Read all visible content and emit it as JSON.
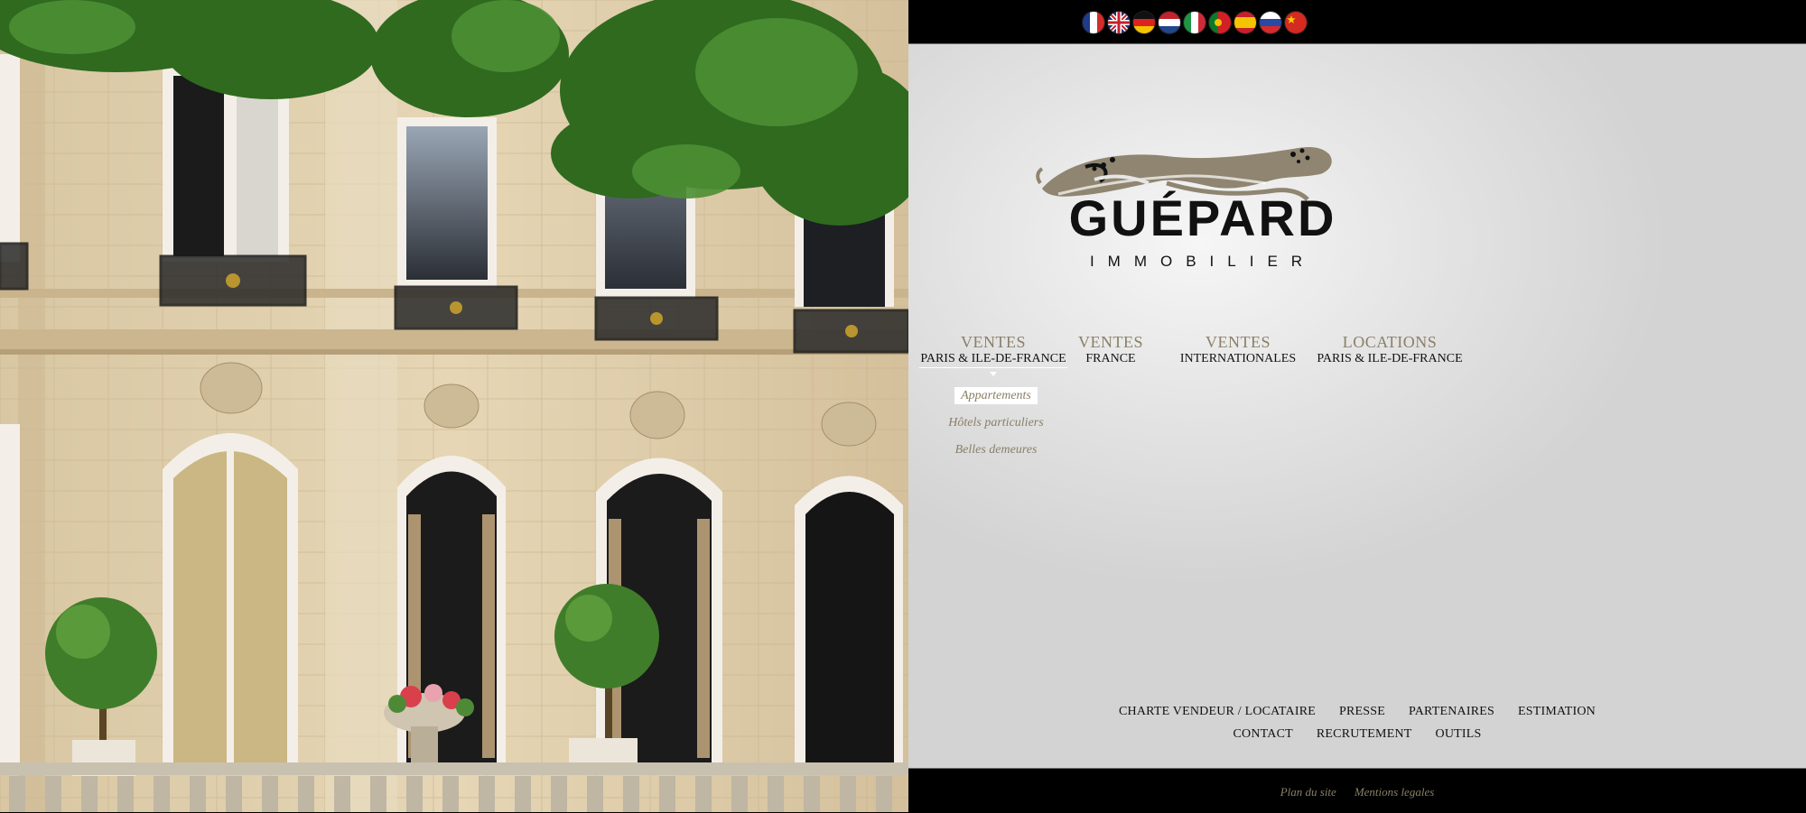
{
  "languages": [
    {
      "code": "fr",
      "icon": "flag-france-icon"
    },
    {
      "code": "en",
      "icon": "flag-uk-icon"
    },
    {
      "code": "de",
      "icon": "flag-germany-icon"
    },
    {
      "code": "nl",
      "icon": "flag-netherlands-icon"
    },
    {
      "code": "it",
      "icon": "flag-italy-icon"
    },
    {
      "code": "pt",
      "icon": "flag-portugal-icon"
    },
    {
      "code": "es",
      "icon": "flag-spain-icon"
    },
    {
      "code": "ru",
      "icon": "flag-russia-icon"
    },
    {
      "code": "cn",
      "icon": "flag-china-icon"
    }
  ],
  "logo": {
    "name": "GUÉPARD",
    "tagline": "IMMOBILIER",
    "icon": "cheetah-logo-icon"
  },
  "nav": [
    {
      "top": "VENTES",
      "sub": "PARIS & ILE-DE-FRANCE",
      "active": true
    },
    {
      "top": "VENTES",
      "sub": "FRANCE"
    },
    {
      "top": "VENTES",
      "sub": "INTERNATIONALES"
    },
    {
      "top": "LOCATIONS",
      "sub": "PARIS & ILE-DE-FRANCE"
    }
  ],
  "submenu": [
    {
      "label": "Appartements",
      "selected": true
    },
    {
      "label": "Hôtels particuliers"
    },
    {
      "label": "Belles demeures"
    }
  ],
  "links_row1": [
    "CHARTE VENDEUR / LOCATAIRE",
    "PRESSE",
    "PARTENAIRES",
    "ESTIMATION"
  ],
  "links_row2": [
    "CONTACT",
    "RECRUTEMENT",
    "OUTILS"
  ],
  "footer": {
    "sitemap": "Plan du site",
    "legal": "Mentions legales"
  },
  "colors": {
    "accent": "#8a7f68",
    "text": "#111111",
    "bar": "#000000"
  }
}
